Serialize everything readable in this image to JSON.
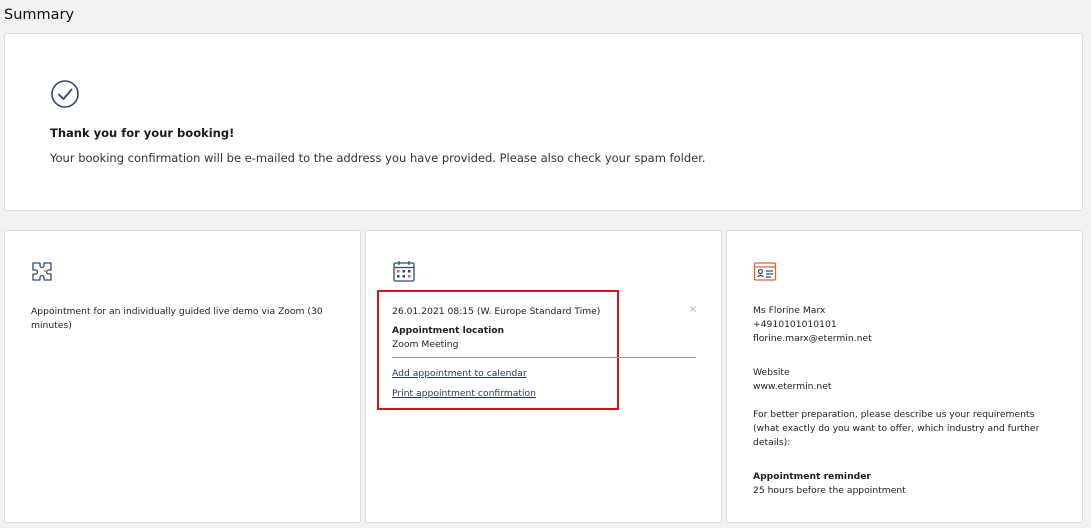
{
  "page": {
    "title": "Summary"
  },
  "confirmation": {
    "heading": "Thank you for your booking!",
    "message": "Your booking confirmation will be e-mailed to the address you have provided. Please also check your spam folder."
  },
  "service": {
    "icon": "puzzle-icon",
    "description": "Appointment for an individually guided live demo via Zoom (30 minutes)"
  },
  "appointment": {
    "icon": "calendar-icon",
    "datetime": "26.01.2021 08:15 (W. Europe Standard Time)",
    "close_glyph": "×",
    "location_label": "Appointment location",
    "location_value": "Zoom Meeting",
    "add_to_calendar": "Add appointment to calendar",
    "print_confirmation": "Print appointment confirmation"
  },
  "customer": {
    "icon": "contact-card-icon",
    "name": "Ms Florine Marx",
    "phone": "+4910101010101",
    "email": "florine.marx@etermin.net",
    "website_label": "Website",
    "website_value": "www.etermin.net",
    "prep_question": "For better preparation, please describe us your requirements (what exactly do you want to offer, which industry and further details):",
    "reminder_label": "Appointment reminder",
    "reminder_value": "25 hours before the appointment"
  },
  "colors": {
    "accent_icon": "#2c4a73",
    "highlight": "#d5141b",
    "orange": "#e8622c",
    "link": "#1d3a6b"
  }
}
